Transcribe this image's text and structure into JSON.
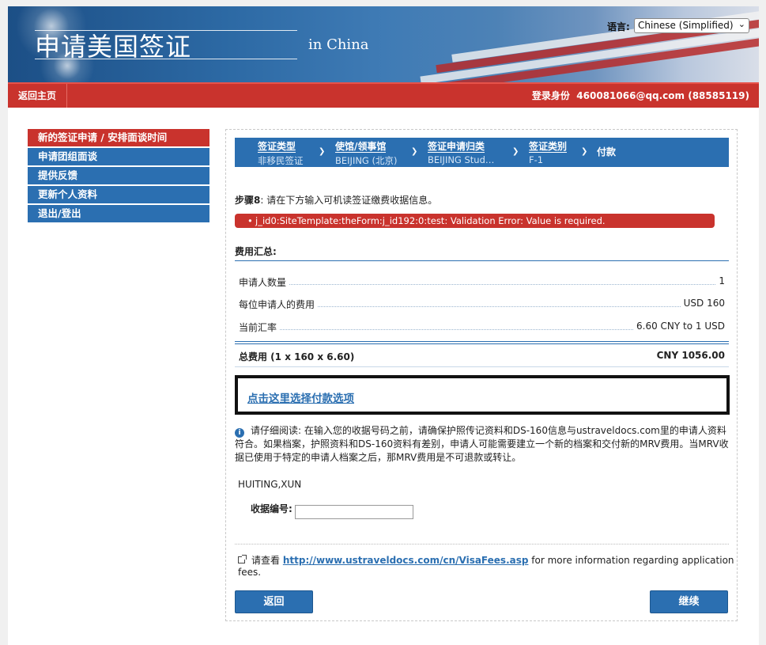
{
  "banner": {
    "title": "申请美国签证",
    "subtitle": "in China",
    "language_label": "语言:",
    "language_value": "Chinese (Simplified)"
  },
  "nav": {
    "home": "返回主页",
    "login_label": "登录身份",
    "login_user": "460081066@qq.com (88585119)"
  },
  "sidebar": {
    "items": [
      {
        "label": "新的签证申请 / 安排面谈时间",
        "active": true
      },
      {
        "label": "申请团组面谈",
        "active": false
      },
      {
        "label": "提供反馈",
        "active": false
      },
      {
        "label": "更新个人资料",
        "active": false
      },
      {
        "label": "退出/登出",
        "active": false
      }
    ]
  },
  "steps": [
    {
      "title": "签证类型",
      "value": "非移民签证"
    },
    {
      "title": "使馆/领事馆",
      "value": "BEIJING (北京)"
    },
    {
      "title": "签证申请归类",
      "value": "BEIJING Stud…"
    },
    {
      "title": "签证类别",
      "value": "F-1"
    },
    {
      "title": "付款",
      "value": ""
    }
  ],
  "step_instruction": {
    "step": "步骤8",
    "text": ": 请在下方输入可机读签证缴费收据信息。"
  },
  "error": "j_id0:SiteTemplate:theForm:j_id192:0:test: Validation Error: Value is required.",
  "fees": {
    "title": "费用汇总:",
    "rows": [
      {
        "label": "申请人数量",
        "value": "1"
      },
      {
        "label": "每位申请人的费用",
        "value": "USD 160"
      },
      {
        "label": "当前汇率",
        "value": "6.60 CNY to 1 USD"
      }
    ],
    "total_label": "总费用 (1 x 160 x 6.60)",
    "total_value": "CNY 1056.00"
  },
  "payment_link": "点击这里选择付款选项",
  "notice": "请仔细阅读: 在输入您的收据号码之前，请确保护照传记资料和DS-160信息与ustraveldocs.com里的申请人资料符合。如果档案，护照资料和DS-160资料有差别，申请人可能需要建立一个新的档案和交付新的MRV费用。当MRV收据已使用于特定的申请人档案之后，那MRV费用是不可退款或转让。",
  "applicant_name": "HUITING,XUN",
  "receipt": {
    "label": "收据编号:",
    "value": ""
  },
  "more_info": {
    "prefix": "请查看",
    "link": "http://www.ustraveldocs.com/cn/VisaFees.asp",
    "suffix": "for more information regarding application fees."
  },
  "buttons": {
    "back": "返回",
    "next": "继续"
  },
  "colors": {
    "brand_blue": "#2b6fb1",
    "nav_red": "#c9332d"
  }
}
